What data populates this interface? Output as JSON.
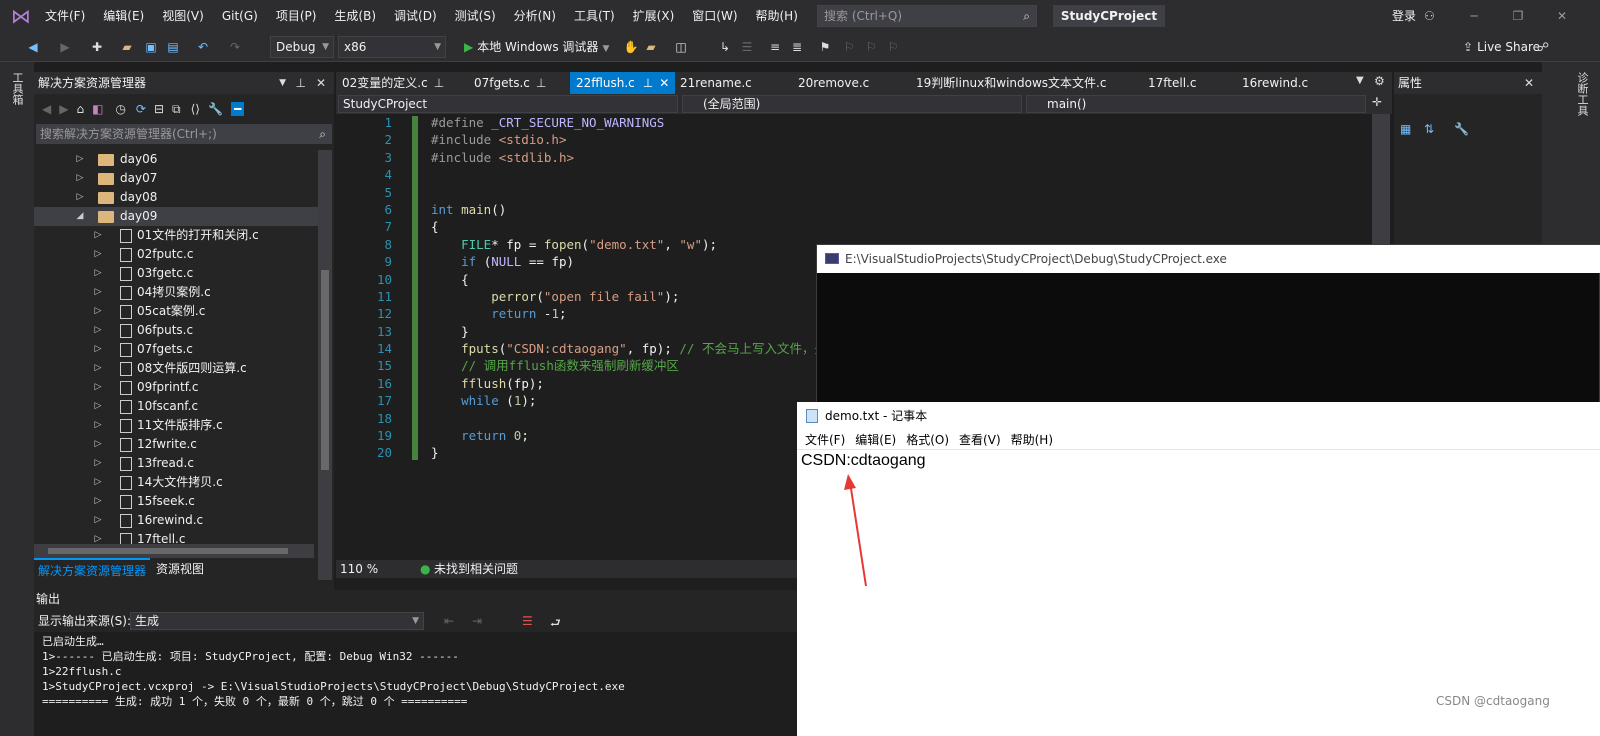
{
  "menubar": {
    "items": [
      "文件(F)",
      "编辑(E)",
      "视图(V)",
      "Git(G)",
      "项目(P)",
      "生成(B)",
      "调试(D)",
      "测试(S)",
      "分析(N)",
      "工具(T)",
      "扩展(X)",
      "窗口(W)",
      "帮助(H)"
    ],
    "search_placeholder": "搜索 (Ctrl+Q)",
    "project_title": "StudyCProject",
    "login": "登录"
  },
  "toolbar": {
    "config": "Debug",
    "platform": "x86",
    "run_label": "本地 Windows 调试器",
    "live_share": "Live Share"
  },
  "left_strip": {
    "label": "工具箱"
  },
  "solution_explorer": {
    "title": "解决方案资源管理器",
    "search_placeholder": "搜索解决方案资源管理器(Ctrl+;)",
    "folders": [
      "day06",
      "day07",
      "day08",
      "day09"
    ],
    "files": [
      "01文件的打开和关闭.c",
      "02fputc.c",
      "03fgetc.c",
      "04拷贝案例.c",
      "05cat案例.c",
      "06fputs.c",
      "07fgets.c",
      "08文件版四则运算.c",
      "09fprintf.c",
      "10fscanf.c",
      "11文件版排序.c",
      "12fwrite.c",
      "13fread.c",
      "14大文件拷贝.c",
      "15fseek.c",
      "16rewind.c",
      "17ftell.c"
    ],
    "bottom_tabs": [
      "解决方案资源管理器",
      "资源视图"
    ]
  },
  "doc_tabs": [
    "02变量的定义.c",
    "07fgets.c",
    "22fflush.c",
    "21rename.c",
    "20remove.c",
    "19判断linux和windows文本文件.c",
    "17ftell.c",
    "16rewind.c"
  ],
  "active_tab": "22fflush.c",
  "nav": {
    "project": "StudyCProject",
    "scope": "(全局范围)",
    "func": "main()"
  },
  "editor": {
    "line_numbers": [
      "1",
      "2",
      "3",
      "4",
      "5",
      "6",
      "7",
      "8",
      "9",
      "10",
      "11",
      "12",
      "13",
      "14",
      "15",
      "16",
      "17",
      "18",
      "19",
      "20"
    ],
    "zoom": "110 %",
    "status": "未找到相关问题"
  },
  "properties": {
    "title": "属性"
  },
  "right_strip": {
    "label": "诊断工具"
  },
  "output": {
    "title": "输出",
    "source_label": "显示输出来源(S):",
    "source_value": "生成",
    "lines": [
      "已启动生成…",
      "1>------ 已启动生成: 项目: StudyCProject, 配置: Debug Win32 ------",
      "1>22fflush.c",
      "1>StudyCProject.vcxproj -> E:\\VisualStudioProjects\\StudyCProject\\Debug\\StudyCProject.exe",
      "========== 生成: 成功 1 个，失败 0 个，最新 0 个，跳过 0 个 =========="
    ]
  },
  "console": {
    "title": "E:\\VisualStudioProjects\\StudyCProject\\Debug\\StudyCProject.exe"
  },
  "notepad": {
    "title": "demo.txt - 记事本",
    "menu": [
      "文件(F)",
      "编辑(E)",
      "格式(O)",
      "查看(V)",
      "帮助(H)"
    ],
    "content": "CSDN:cdtaogang"
  },
  "watermark": "CSDN @cdtaogang",
  "colors": {
    "accent": "#007acc",
    "arrow": "#e53935"
  }
}
